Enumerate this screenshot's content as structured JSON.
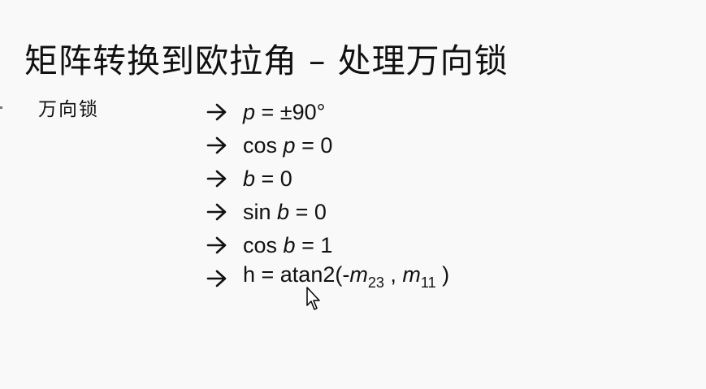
{
  "slide": {
    "title": "矩阵转换到欧拉角 – 处理万向锁",
    "topic_label": "万向锁",
    "lines": [
      {
        "name": "p-equals-90",
        "parts": [
          {
            "text": "p",
            "style": "var"
          },
          {
            "text": " = ±90°",
            "style": "normal"
          }
        ]
      },
      {
        "name": "cos-p-equals-0",
        "parts": [
          {
            "text": "cos ",
            "style": "normal"
          },
          {
            "text": "p",
            "style": "var"
          },
          {
            "text": " = 0",
            "style": "normal"
          }
        ]
      },
      {
        "name": "b-equals-0",
        "parts": [
          {
            "text": "b",
            "style": "var"
          },
          {
            "text": " = 0",
            "style": "normal"
          }
        ]
      },
      {
        "name": "sin-b-equals-0",
        "parts": [
          {
            "text": "sin ",
            "style": "normal"
          },
          {
            "text": "b",
            "style": "var"
          },
          {
            "text": " = 0",
            "style": "normal"
          }
        ]
      },
      {
        "name": "cos-b-equals-1",
        "parts": [
          {
            "text": "cos ",
            "style": "normal"
          },
          {
            "text": "b",
            "style": "var"
          },
          {
            "text": " = 1",
            "style": "normal"
          }
        ]
      },
      {
        "name": "h-equals-atan2",
        "parts": [
          {
            "text": "h = atan2(-",
            "style": "normal"
          },
          {
            "text": "m",
            "style": "var"
          },
          {
            "text": "23",
            "style": "sub"
          },
          {
            "text": " , ",
            "style": "normal"
          },
          {
            "text": "m",
            "style": "var"
          },
          {
            "text": "11",
            "style": "sub"
          },
          {
            "text": " )",
            "style": "normal"
          }
        ]
      }
    ]
  },
  "icons": {
    "line_arrow": "right-arrow-icon",
    "pointer": "mouse-cursor-icon"
  }
}
